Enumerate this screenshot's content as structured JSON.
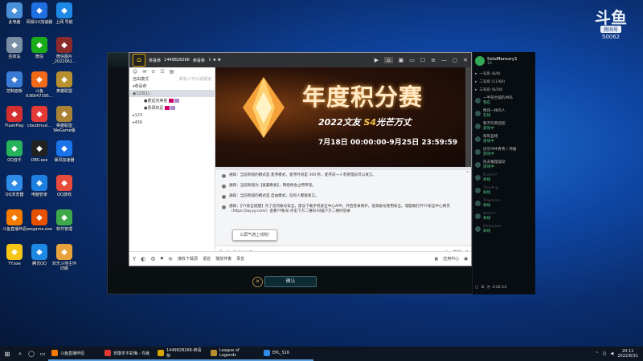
{
  "watermark": {
    "logo": "斗鱼",
    "badge": "房间号",
    "room": "50062"
  },
  "desktop_icons": [
    {
      "label": "此电脑",
      "icon": "computer-icon",
      "color": "#4a90d9"
    },
    {
      "label": "网易UU加速器",
      "icon": "uu-accelerator-icon",
      "color": "#1f6fe0"
    },
    {
      "label": "上网 导航",
      "icon": "browser-icon",
      "color": "#1e88e5"
    },
    {
      "label": "回收站",
      "icon": "recycle-bin-icon",
      "color": "#7a8fa3"
    },
    {
      "label": "微信",
      "icon": "wechat-icon",
      "color": "#1aad19"
    },
    {
      "label": "微信图片_2022061...",
      "icon": "image-file-icon",
      "color": "#8a2a2a"
    },
    {
      "label": "控制面板",
      "icon": "control-panel-icon",
      "color": "#3a7bd5"
    },
    {
      "label": "斗鱼 636647395...",
      "icon": "douyu-icon",
      "color": "#f06a1a"
    },
    {
      "label": "英雄联盟",
      "icon": "lol-icon",
      "color": "#b8902f"
    },
    {
      "label": "FlashPlay",
      "icon": "flash-icon",
      "color": "#d32f2f"
    },
    {
      "label": "cloudmusi...",
      "icon": "netease-music-icon",
      "color": "#e53935"
    },
    {
      "label": "英雄联盟WeGame版",
      "icon": "wegame-lol-icon",
      "color": "#a98235"
    },
    {
      "label": "QQ音乐",
      "icon": "qq-music-icon",
      "color": "#26b35a"
    },
    {
      "label": "OBS.exe",
      "icon": "obs-icon",
      "color": "#222222"
    },
    {
      "label": "暴风加速器",
      "icon": "accelerator-icon",
      "color": "#1a73e8"
    },
    {
      "label": "QQ浏览器",
      "icon": "qq-browser-icon",
      "color": "#2e8be8"
    },
    {
      "label": "电脑管家",
      "icon": "pc-manager-icon",
      "color": "#1d7fe0"
    },
    {
      "label": "QQ游戏",
      "icon": "qq-game-icon",
      "color": "#e74c3c"
    },
    {
      "label": "斗鱼直播伴侣",
      "icon": "douyu-companion-icon",
      "color": "#f57c00"
    },
    {
      "label": "wegame.exe",
      "icon": "wegame-icon",
      "color": "#e65100"
    },
    {
      "label": "软件管理",
      "icon": "software-manager-icon",
      "color": "#3ea94b"
    },
    {
      "label": "YY.exe",
      "icon": "yy-icon",
      "color": "#f5c518"
    },
    {
      "label": "腾讯QQ",
      "icon": "qq-icon",
      "color": "#1e88e5"
    },
    {
      "label": "欢乐斗地主环 旧版",
      "icon": "doudizhu-icon",
      "color": "#e8a33d"
    }
  ],
  "chat": {
    "title": "恭喜恭",
    "channel_id": "1449828266",
    "title_suffix": "恭喜恭",
    "sidebar": {
      "mode": "自由模式",
      "search_hint": "新标人可以进频道",
      "root": "恭喜恭",
      "rows": [
        {
          "label": "123",
          "count": "(1)"
        },
        {
          "label": "邂逅完美者",
          "indent": true
        },
        {
          "label": "佩佩知足",
          "indent": true
        },
        {
          "label": "123"
        },
        {
          "label": "456"
        }
      ]
    },
    "banner": {
      "title": "年度积分赛",
      "subtitle_a": "2022文",
      "subtitle_b": "友",
      "subtitle_c": "S4",
      "subtitle_d": "光芒万丈",
      "date": "7月18日 00:00:00-9月25日 23:59:59"
    },
    "messages": [
      {
        "text": "通知：当前频道的模式是 麦序模式，麦序时间是 300 秒，麦序前一人有管理员可以发言。"
      },
      {
        "text": "通知：当前频道为【麦霸看板】，网络将会占用带宽。"
      },
      {
        "text": "通知：当前频道的模式是 自由模式，任何人都能发言。"
      },
      {
        "text": "通知：【YY安全提醒】为了您的账号安全，建议下载手机安全中心APP，开启登录保护，提高账号使用安全。电脑端打开YY安全中心网页（https://aq.yy.com/）查看YY账号·点击下方二维码·扫描下方二维码登录",
        "link": "https://aq.yy.com/"
      }
    ],
    "tooltip": "公屏气泡上线啦!",
    "input_placeholder": "说点什么吧...",
    "send_label": "发送",
    "bottom_items": [
      "语音",
      "播放伴奏",
      "录音"
    ],
    "bottom_left": "接收下载源",
    "bottom_right": "应用中心"
  },
  "game": {
    "confirm_label": "确认"
  },
  "right_panel": {
    "user": "SoloMemory1",
    "user_sub": "10",
    "rows": [
      {
        "label": "一号房 (6/8)"
      },
      {
        "label": "二号房 (11/60)"
      },
      {
        "label": "三号房 (6/30)"
      },
      {
        "label": "一半符合摆的书吗",
        "sub": "我在"
      },
      {
        "label": "像风一样的人",
        "sub": "在线"
      },
      {
        "label": "我不的英团团",
        "sub": "游戏中"
      },
      {
        "label": "帮呀自相",
        "sub": "游戏中"
      },
      {
        "label": "虎牙冲冲青青丨神器",
        "sub": "游戏中"
      },
      {
        "label": "风去推理摆动",
        "sub": "游戏中"
      },
      {
        "label": "Rude47",
        "sub": "离线",
        "dim": true
      },
      {
        "label": "7iou4ng",
        "sub": "离线",
        "dim": true
      },
      {
        "label": "Traprome",
        "sub": "离线",
        "dim": true
      },
      {
        "label": "leomin",
        "sub": "离线",
        "dim": true
      },
      {
        "label": "Deepcare",
        "sub": "离线",
        "dim": true
      }
    ],
    "bottom_time": "4:02:14"
  },
  "taskbar": {
    "tasks": [
      {
        "label": "斗鱼直播伴侣",
        "color": "#f57c00"
      },
      {
        "label": "安徽冬不彩悔 - 许嵩",
        "color": "#e53935"
      },
      {
        "label": "1449828266-恭喜恭",
        "color": "#d8a400"
      },
      {
        "label": "League of Legends",
        "color": "#b8902f"
      },
      {
        "label": "EPL_S16",
        "color": "#2e8be8"
      }
    ],
    "time": "20:11",
    "date": "2022/8/31"
  }
}
